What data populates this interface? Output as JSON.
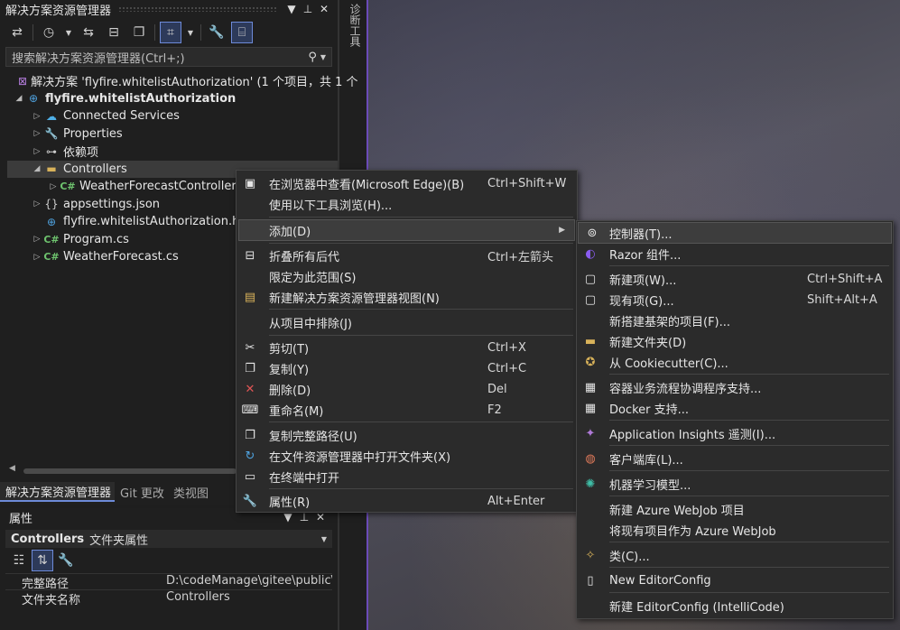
{
  "solution_explorer": {
    "title": "解决方案资源管理器",
    "search_placeholder": "搜索解决方案资源管理器(Ctrl+;)",
    "tree": [
      {
        "label": "解决方案 'flyfire.whitelistAuthorization' (1 个项目，共 1 个",
        "icon": "solution-icon"
      },
      {
        "label": "flyfire.whitelistAuthorization",
        "icon": "web-project-icon"
      },
      {
        "label": "Connected Services",
        "icon": "connected-services-icon"
      },
      {
        "label": "Properties",
        "icon": "properties-folder-icon"
      },
      {
        "label": "依赖项",
        "icon": "dependencies-icon"
      },
      {
        "label": "Controllers",
        "icon": "folder-icon"
      },
      {
        "label": "WeatherForecastController",
        "icon": "csharp-file-icon"
      },
      {
        "label": "appsettings.json",
        "icon": "json-file-icon"
      },
      {
        "label": "flyfire.whitelistAuthorization.h",
        "icon": "http-file-icon"
      },
      {
        "label": "Program.cs",
        "icon": "csharp-file-icon"
      },
      {
        "label": "WeatherForecast.cs",
        "icon": "csharp-file-icon"
      }
    ],
    "tabs": [
      "解决方案资源管理器",
      "Git 更改",
      "类视图"
    ]
  },
  "side_tool": {
    "label": "诊断工具"
  },
  "properties": {
    "title": "属性",
    "object_name": "Controllers",
    "object_type": "文件夹属性",
    "rows": [
      {
        "key": "完整路径",
        "value": "D:\\codeManage\\gitee\\public\\fly"
      },
      {
        "key": "文件夹名称",
        "value": "Controllers"
      }
    ]
  },
  "context_menu": {
    "items": [
      {
        "label": "在浏览器中查看(Microsoft Edge)(B)",
        "shortcut": "Ctrl+Shift+W",
        "icon": "browser-view-icon"
      },
      {
        "label": "使用以下工具浏览(H)...",
        "shortcut": "",
        "icon": ""
      },
      {
        "label": "添加(D)",
        "shortcut": "",
        "icon": ""
      },
      {
        "label": "折叠所有后代",
        "shortcut": "Ctrl+左箭头",
        "icon": "collapse-icon"
      },
      {
        "label": "限定为此范围(S)",
        "shortcut": "",
        "icon": ""
      },
      {
        "label": "新建解决方案资源管理器视图(N)",
        "shortcut": "",
        "icon": "new-view-icon"
      },
      {
        "label": "从项目中排除(J)",
        "shortcut": "",
        "icon": ""
      },
      {
        "label": "剪切(T)",
        "shortcut": "Ctrl+X",
        "icon": "scissors-icon"
      },
      {
        "label": "复制(Y)",
        "shortcut": "Ctrl+C",
        "icon": "copy-icon"
      },
      {
        "label": "删除(D)",
        "shortcut": "Del",
        "icon": "delete-icon"
      },
      {
        "label": "重命名(M)",
        "shortcut": "F2",
        "icon": "rename-icon"
      },
      {
        "label": "复制完整路径(U)",
        "shortcut": "",
        "icon": "copy-path-icon"
      },
      {
        "label": "在文件资源管理器中打开文件夹(X)",
        "shortcut": "",
        "icon": "open-folder-icon"
      },
      {
        "label": "在终端中打开",
        "shortcut": "",
        "icon": "terminal-icon"
      },
      {
        "label": "属性(R)",
        "shortcut": "Alt+Enter",
        "icon": "wrench-icon"
      }
    ]
  },
  "add_submenu": {
    "items": [
      {
        "label": "控制器(T)...",
        "shortcut": "",
        "icon": "controller-icon"
      },
      {
        "label": "Razor 组件...",
        "shortcut": "",
        "icon": "razor-icon"
      },
      {
        "label": "新建项(W)...",
        "shortcut": "Ctrl+Shift+A",
        "icon": "new-item-icon"
      },
      {
        "label": "现有项(G)...",
        "shortcut": "Shift+Alt+A",
        "icon": "existing-item-icon"
      },
      {
        "label": "新搭建基架的项目(F)...",
        "shortcut": "",
        "icon": ""
      },
      {
        "label": "新建文件夹(D)",
        "shortcut": "",
        "icon": "new-folder-icon"
      },
      {
        "label": "从 Cookiecutter(C)...",
        "shortcut": "",
        "icon": "cookiecutter-icon"
      },
      {
        "label": "容器业务流程协调程序支持...",
        "shortcut": "",
        "icon": "container-icon"
      },
      {
        "label": "Docker 支持...",
        "shortcut": "",
        "icon": "docker-icon"
      },
      {
        "label": "Application Insights 遥测(I)...",
        "shortcut": "",
        "icon": "insights-icon"
      },
      {
        "label": "客户端库(L)...",
        "shortcut": "",
        "icon": "globe-icon"
      },
      {
        "label": "机器学习模型...",
        "shortcut": "",
        "icon": "ml-icon"
      },
      {
        "label": "新建 Azure WebJob 项目",
        "shortcut": "",
        "icon": ""
      },
      {
        "label": "将现有项目作为 Azure WebJob",
        "shortcut": "",
        "icon": ""
      },
      {
        "label": "类(C)...",
        "shortcut": "",
        "icon": "class-icon"
      },
      {
        "label": "New EditorConfig",
        "shortcut": "",
        "icon": "file-icon"
      },
      {
        "label": "新建 EditorConfig (IntelliCode)",
        "shortcut": "",
        "icon": ""
      }
    ]
  }
}
